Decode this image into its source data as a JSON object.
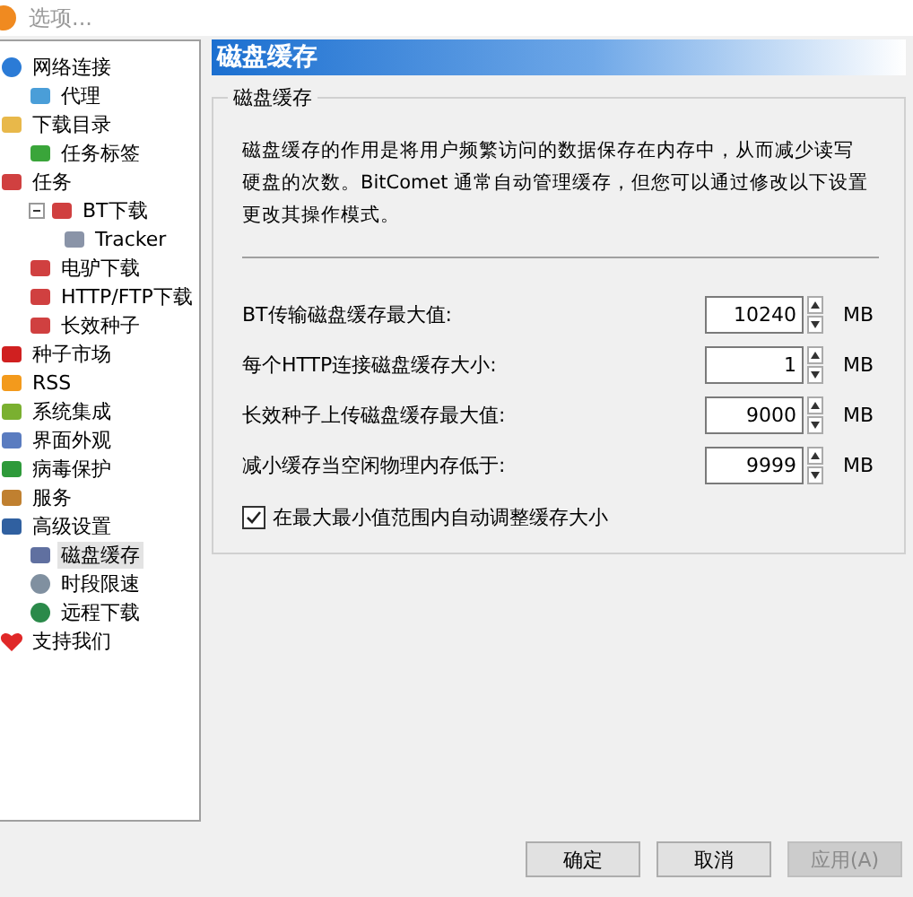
{
  "window": {
    "title": "选项..."
  },
  "tree": [
    {
      "label": "网络连接",
      "selected": false,
      "children": [
        {
          "label": "代理",
          "selected": false
        }
      ]
    },
    {
      "label": "下载目录",
      "selected": false,
      "children": [
        {
          "label": "任务标签",
          "selected": false
        }
      ]
    },
    {
      "label": "任务",
      "selected": false,
      "children": [
        {
          "label": "BT下载",
          "selected": false,
          "expanded": true,
          "children": [
            {
              "label": "Tracker",
              "selected": false
            }
          ]
        },
        {
          "label": "电驴下载",
          "selected": false
        },
        {
          "label": "HTTP/FTP下载",
          "selected": false
        },
        {
          "label": "长效种子",
          "selected": false
        }
      ]
    },
    {
      "label": "种子市场",
      "selected": false
    },
    {
      "label": "RSS",
      "selected": false
    },
    {
      "label": "系统集成",
      "selected": false
    },
    {
      "label": "界面外观",
      "selected": false
    },
    {
      "label": "病毒保护",
      "selected": false
    },
    {
      "label": "服务",
      "selected": false
    },
    {
      "label": "高级设置",
      "selected": false,
      "children": [
        {
          "label": "磁盘缓存",
          "selected": true
        },
        {
          "label": "时段限速",
          "selected": false
        },
        {
          "label": "远程下载",
          "selected": false
        }
      ]
    },
    {
      "label": "支持我们",
      "selected": false
    }
  ],
  "page": {
    "title": "磁盘缓存",
    "group": "磁盘缓存",
    "description": "磁盘缓存的作用是将用户频繁访问的数据保存在内存中，从而减少读写硬盘的次数。BitComet 通常自动管理缓存，但您可以通过修改以下设置更改其操作模式。",
    "settings": [
      {
        "label": "BT传输磁盘缓存最大值:",
        "value": "10240",
        "unit": "MB"
      },
      {
        "label": "每个HTTP连接磁盘缓存大小:",
        "value": "1",
        "unit": "MB"
      },
      {
        "label": "长效种子上传磁盘缓存最大值:",
        "value": "9000",
        "unit": "MB"
      },
      {
        "label": "减小缓存当空闲物理内存低于:",
        "value": "9999",
        "unit": "MB"
      }
    ],
    "checkbox": {
      "label": "在最大最小值范围内自动调整缓存大小",
      "checked": true
    }
  },
  "buttons": [
    {
      "label": "确定",
      "disabled": false
    },
    {
      "label": "取消",
      "disabled": false
    },
    {
      "label": "应用(A)",
      "disabled": true
    }
  ]
}
